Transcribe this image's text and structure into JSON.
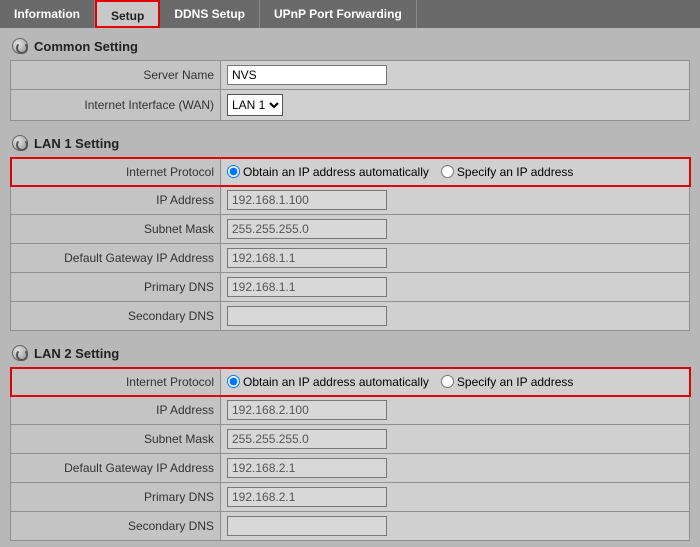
{
  "tabs": {
    "information": "Information",
    "setup": "Setup",
    "ddns": "DDNS Setup",
    "upnp": "UPnP Port Forwarding"
  },
  "common": {
    "header": "Common Setting",
    "serverNameLabel": "Server Name",
    "serverNameValue": "NVS",
    "wanLabel": "Internet Interface (WAN)",
    "wanValue": "LAN 1"
  },
  "lan1": {
    "header": "LAN 1 Setting",
    "protocolLabel": "Internet Protocol",
    "radioAuto": "Obtain an IP address automatically",
    "radioManual": "Specify an IP address",
    "ipLabel": "IP Address",
    "ipValue": "192.168.1.100",
    "subnetLabel": "Subnet Mask",
    "subnetValue": "255.255.255.0",
    "gatewayLabel": "Default Gateway IP Address",
    "gatewayValue": "192.168.1.1",
    "primaryDnsLabel": "Primary DNS",
    "primaryDnsValue": "192.168.1.1",
    "secondaryDnsLabel": "Secondary DNS",
    "secondaryDnsValue": ""
  },
  "lan2": {
    "header": "LAN 2 Setting",
    "protocolLabel": "Internet Protocol",
    "radioAuto": "Obtain an IP address automatically",
    "radioManual": "Specify an IP address",
    "ipLabel": "IP Address",
    "ipValue": "192.168.2.100",
    "subnetLabel": "Subnet Mask",
    "subnetValue": "255.255.255.0",
    "gatewayLabel": "Default Gateway IP Address",
    "gatewayValue": "192.168.2.1",
    "primaryDnsLabel": "Primary DNS",
    "primaryDnsValue": "192.168.2.1",
    "secondaryDnsLabel": "Secondary DNS",
    "secondaryDnsValue": ""
  }
}
